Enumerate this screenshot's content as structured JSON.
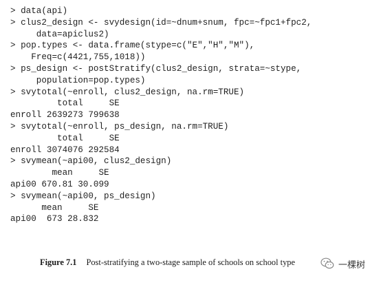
{
  "code_lines": [
    "> data(api)",
    "> clus2_design <- svydesign(id=~dnum+snum, fpc=~fpc1+fpc2,",
    "     data=apiclus2)",
    "> pop.types <- data.frame(stype=c(\"E\",\"H\",\"M\"),",
    "    Freq=c(4421,755,1018))",
    "> ps_design <- postStratify(clus2_design, strata=~stype,",
    "     population=pop.types)",
    "> svytotal(~enroll, clus2_design, na.rm=TRUE)",
    "         total     SE",
    "enroll 2639273 799638",
    "> svytotal(~enroll, ps_design, na.rm=TRUE)",
    "         total     SE",
    "enroll 3074076 292584",
    "> svymean(~api00, clus2_design)",
    "        mean     SE",
    "api00 670.81 30.099",
    "> svymean(~api00, ps_design)",
    "      mean     SE",
    "api00  673 28.832"
  ],
  "caption": {
    "label": "Figure 7.1",
    "text": "Post-stratifying a two-stage sample of schools on school type"
  },
  "watermark": {
    "text": "一棵树",
    "icon": "wechat-icon"
  }
}
